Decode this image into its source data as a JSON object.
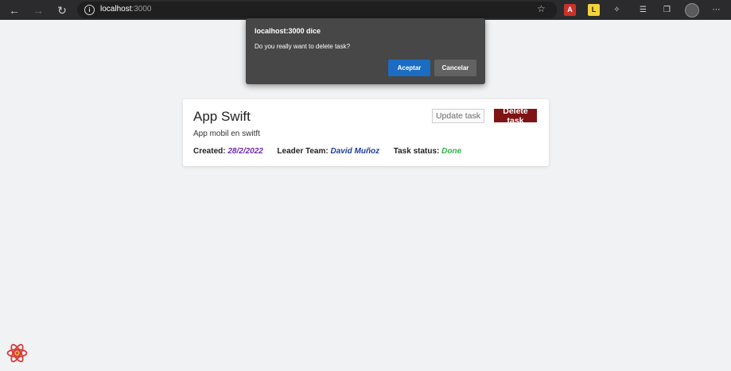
{
  "browser": {
    "url_host": "localhost",
    "url_port": ":3000"
  },
  "dialog": {
    "title": "localhost:3000 dice",
    "message": "Do you really want to delete task?",
    "accept_label": "Aceptar",
    "cancel_label": "Cancelar"
  },
  "task": {
    "title": "App Swift",
    "description": "App mobil en switft",
    "update_label": "Update task",
    "delete_label": "Delete task",
    "created_label": "Created:",
    "created_value": "28/2/2022",
    "leader_label": "Leader Team:",
    "leader_value": "David Muñoz",
    "status_label": "Task status:",
    "status_value": "Done"
  },
  "colors": {
    "created": "#6f2bb0",
    "leader": "#1f3f96",
    "status": "#33b04a",
    "delete_button": "#7f1414",
    "accept_button": "#1a6dc2"
  },
  "icons": [
    "back-icon",
    "forward-icon",
    "refresh-icon",
    "info-icon",
    "favorites-star-icon",
    "extension-icons",
    "settings-more-icon",
    "react-logo-icon"
  ]
}
